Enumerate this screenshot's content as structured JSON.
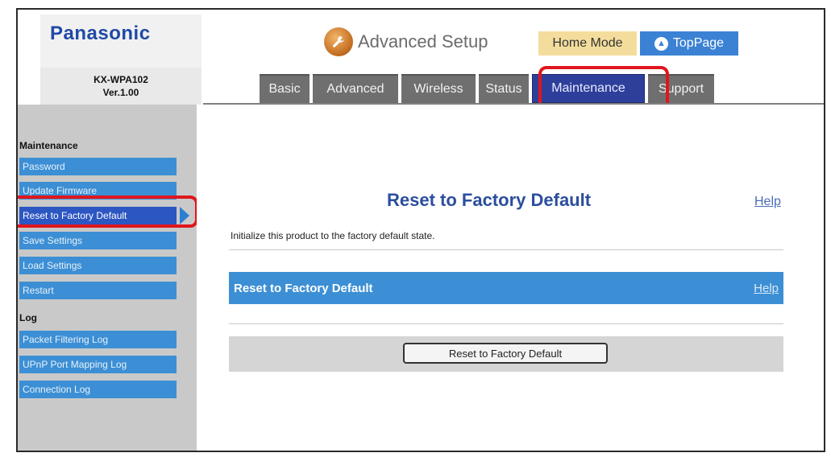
{
  "header": {
    "brand": "Panasonic",
    "model_line1": "KX-WPA102",
    "model_line2": "Ver.1.00",
    "setup_title": "Advanced Setup",
    "setup_icon": "wrench-icon",
    "home_mode_label": "Home Mode",
    "toppage_label": "TopPage",
    "tabs": [
      {
        "label": "Basic"
      },
      {
        "label": "Advanced"
      },
      {
        "label": "Wireless"
      },
      {
        "label": "Status"
      },
      {
        "label": "Maintenance"
      },
      {
        "label": "Support"
      }
    ],
    "active_tab": "Maintenance"
  },
  "sidebar": {
    "section1": "Maintenance",
    "maintenance_items": [
      {
        "label": "Password"
      },
      {
        "label": "Update Firmware"
      },
      {
        "label": "Reset to Factory Default"
      },
      {
        "label": "Save Settings"
      },
      {
        "label": "Load Settings"
      },
      {
        "label": "Restart"
      }
    ],
    "section2": "Log",
    "log_items": [
      {
        "label": "Packet Filtering Log"
      },
      {
        "label": "UPnP Port Mapping Log"
      },
      {
        "label": "Connection Log"
      }
    ],
    "active_item": "Reset to Factory Default"
  },
  "main": {
    "title": "Reset to Factory Default",
    "help_label": "Help",
    "description": "Initialize this product to the factory default state.",
    "section_title": "Reset to Factory Default",
    "section_help_label": "Help",
    "button_label": "Reset to Factory Default"
  },
  "colors": {
    "brand_blue": "#1f4aa6",
    "menu_blue": "#3c8fd4",
    "active_tab": "#2d3f9a",
    "highlight_red": "#e0161c",
    "home_mode_bg": "#f4dd9c"
  }
}
